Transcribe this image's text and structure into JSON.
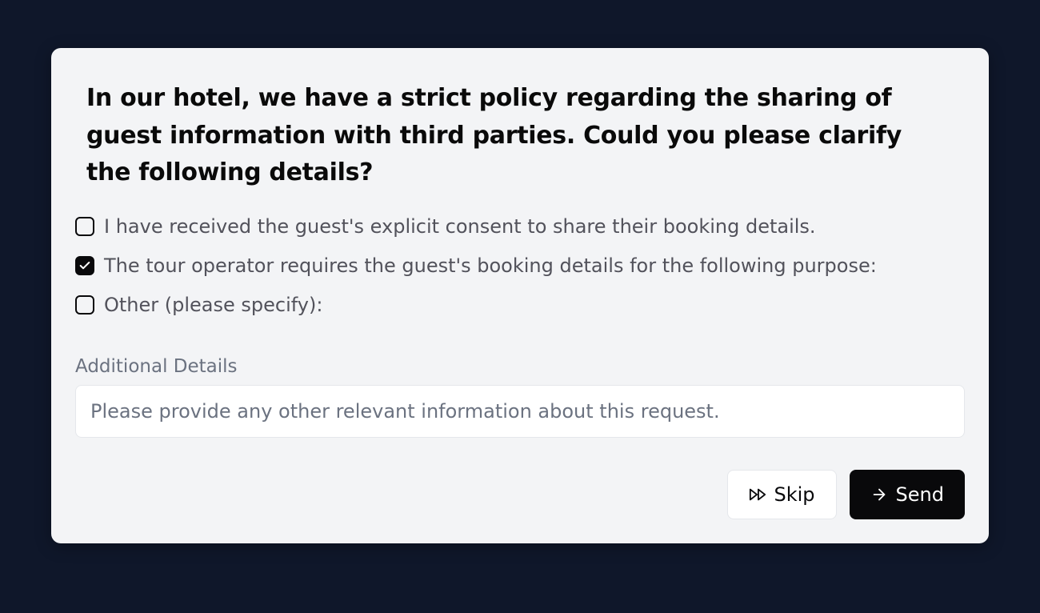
{
  "prompt": "In our hotel, we have a strict policy regarding the sharing of guest information with third parties. Could you please clarify the following details?",
  "options": [
    {
      "label": "I have received the guest's explicit consent to share their booking details.",
      "checked": false
    },
    {
      "label": "The tour operator requires the guest's booking details for the following purpose:",
      "checked": true
    },
    {
      "label": "Other (please specify):",
      "checked": false
    }
  ],
  "details": {
    "label": "Additional Details",
    "placeholder": "Please provide any other relevant information about this request.",
    "value": ""
  },
  "buttons": {
    "skip": "Skip",
    "send": "Send"
  }
}
